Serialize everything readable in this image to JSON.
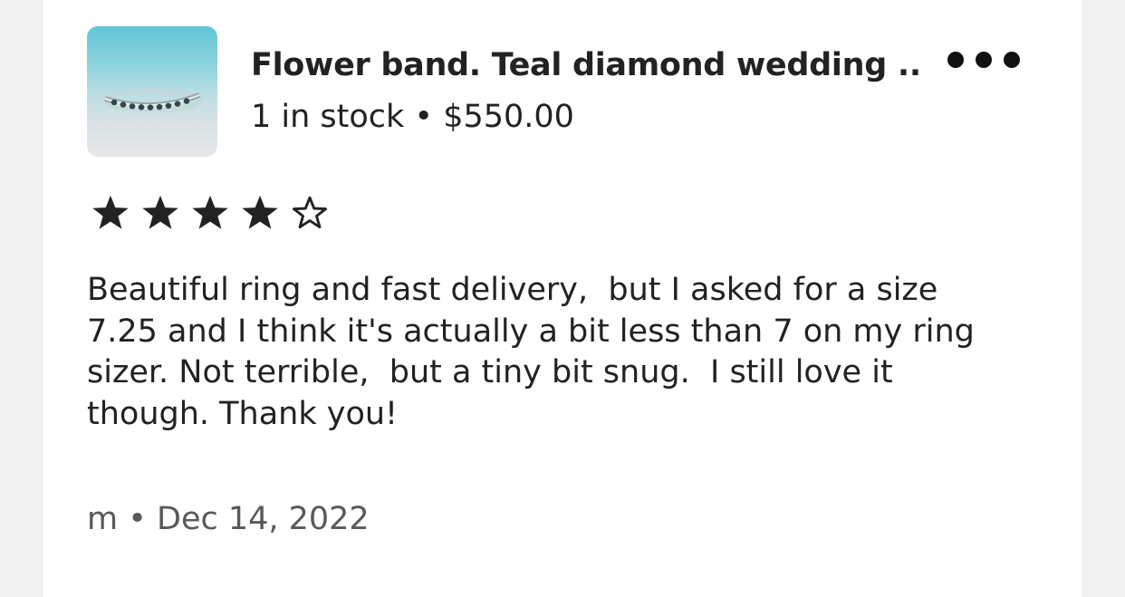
{
  "listing": {
    "title": "Flower band. Teal diamond wedding ...",
    "stock_and_price": "1 in stock • $550.00",
    "thumbnail": "ring-photo"
  },
  "more_menu": {
    "icon": "more-horizontal-icon"
  },
  "rating": {
    "value": 4,
    "max": 5
  },
  "review": {
    "text": "Beautiful ring and fast delivery,  but I asked for a size\n7.25 and I think it's actually a bit less than 7 on my ring\nsizer. Not terrible,  but a tiny bit snug.  I still love it\nthough. Thank you!"
  },
  "footer": {
    "byline": "m • Dec 14, 2022"
  },
  "colors": {
    "text": "#222222",
    "muted": "#595959",
    "background": "#ffffff",
    "page_background": "#f2f2f2"
  }
}
